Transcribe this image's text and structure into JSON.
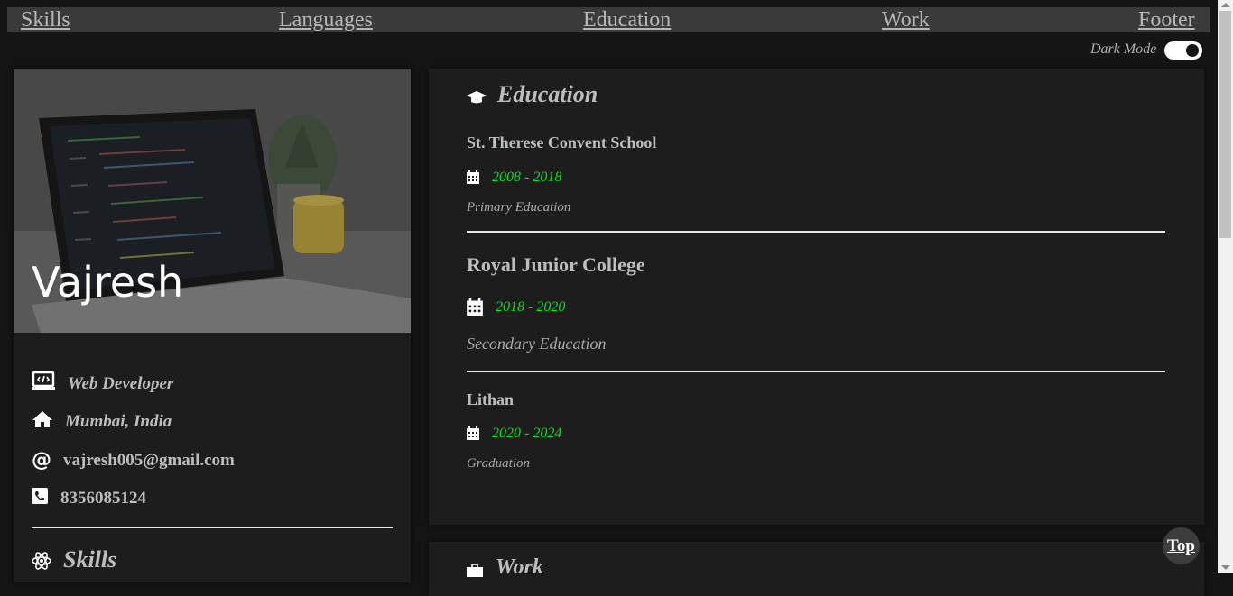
{
  "nav": {
    "items": [
      "Skills",
      "Languages",
      "Education",
      "Work",
      "Footer"
    ]
  },
  "dark_mode": {
    "label": "Dark Mode",
    "on": true
  },
  "profile": {
    "name": "Vajresh",
    "role": "Web Developer",
    "location": "Mumbai, India",
    "email": "vajresh005@gmail.com",
    "phone": "8356085124",
    "icons": [
      "laptop-icon",
      "home-icon",
      "at-icon",
      "phone-icon"
    ]
  },
  "skills": {
    "title": "Skills",
    "icon": "atom-icon"
  },
  "education": {
    "title": "Education",
    "icon": "graduation-cap-icon",
    "entries": [
      {
        "school": "St. Therese Convent School",
        "years": "2008 - 2018",
        "level": "Primary Education"
      },
      {
        "school": "Royal Junior College",
        "years": "2018 - 2020",
        "level": "Secondary Education"
      },
      {
        "school": "Lithan",
        "years": "2020 - 2024",
        "level": "Graduation"
      }
    ]
  },
  "work": {
    "title": "Work",
    "icon": "briefcase-icon"
  },
  "top_button": {
    "label": "Top"
  },
  "colors": {
    "background": "#151515",
    "card": "#1d1d1d",
    "accent_years": "#00e31f",
    "text": "#bdbdbd"
  }
}
